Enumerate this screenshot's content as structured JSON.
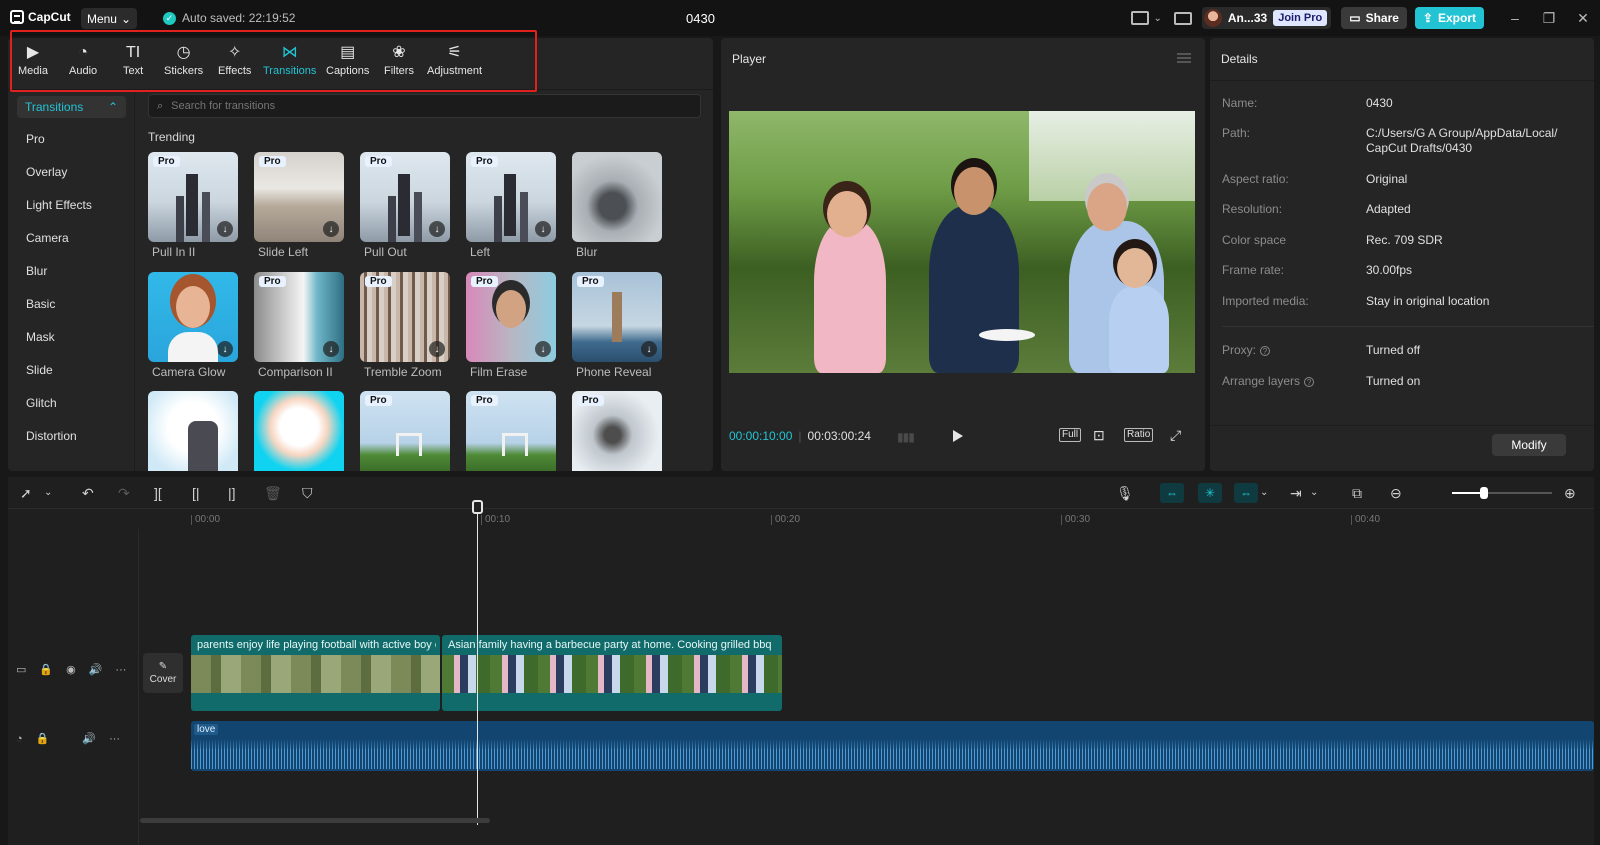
{
  "titlebar": {
    "app_name": "CapCut",
    "menu_label": "Menu",
    "autosave": "Auto saved: 22:19:52",
    "project_title": "0430",
    "user_name": "An...33",
    "join_pro": "Join Pro",
    "share_label": "Share",
    "export_label": "Export"
  },
  "toolbar": {
    "tools": [
      {
        "label": "Media",
        "icon": "media-icon"
      },
      {
        "label": "Audio",
        "icon": "audio-icon"
      },
      {
        "label": "Text",
        "icon": "text-icon"
      },
      {
        "label": "Stickers",
        "icon": "stickers-icon"
      },
      {
        "label": "Effects",
        "icon": "effects-icon"
      },
      {
        "label": "Transitions",
        "icon": "transitions-icon",
        "active": true
      },
      {
        "label": "Captions",
        "icon": "captions-icon"
      },
      {
        "label": "Filters",
        "icon": "filters-icon"
      },
      {
        "label": "Adjustment",
        "icon": "adjustment-icon"
      }
    ],
    "accent_color": "#22c4d4",
    "highlight_color": "#e0221e"
  },
  "sidebar": {
    "active": "Transitions",
    "items": [
      "Pro",
      "Overlay",
      "Light Effects",
      "Camera",
      "Blur",
      "Basic",
      "Mask",
      "Slide",
      "Glitch",
      "Distortion"
    ]
  },
  "search": {
    "placeholder": "Search for transitions"
  },
  "trending": {
    "title": "Trending",
    "items": [
      {
        "label": "Pull In II",
        "pro": true
      },
      {
        "label": "Slide Left",
        "pro": true
      },
      {
        "label": "Pull Out",
        "pro": true
      },
      {
        "label": "Left",
        "pro": true
      },
      {
        "label": "Blur",
        "pro": false
      },
      {
        "label": "Camera Glow",
        "pro": false
      },
      {
        "label": "Comparison II",
        "pro": true
      },
      {
        "label": "Tremble Zoom",
        "pro": true
      },
      {
        "label": "Film Erase",
        "pro": true
      },
      {
        "label": "Phone Reveal",
        "pro": true
      },
      {
        "label": "",
        "pro": false
      },
      {
        "label": "",
        "pro": false
      },
      {
        "label": "",
        "pro": true
      },
      {
        "label": "",
        "pro": true
      },
      {
        "label": "",
        "pro": true
      }
    ],
    "pro_badge": "Pro"
  },
  "player": {
    "title": "Player",
    "current_time": "00:00:10:00",
    "total_time": "00:03:00:24",
    "controls": [
      "Full",
      "Ratio"
    ]
  },
  "details": {
    "title": "Details",
    "rows": [
      {
        "key": "Name:",
        "value": "0430"
      },
      {
        "key": "Path:",
        "value": "C:/Users/G A Group/AppData/Local/ CapCut Drafts/0430"
      },
      {
        "key": "Aspect ratio:",
        "value": "Original"
      },
      {
        "key": "Resolution:",
        "value": "Adapted"
      },
      {
        "key": "Color space",
        "value": "Rec. 709 SDR"
      },
      {
        "key": "Frame rate:",
        "value": "30.00fps"
      },
      {
        "key": "Imported media:",
        "value": "Stay in original location"
      },
      {
        "key": "Proxy:",
        "value": "Turned off"
      },
      {
        "key": "Arrange layers",
        "value": "Turned on"
      }
    ],
    "modify_label": "Modify"
  },
  "timeline": {
    "ruler": [
      "00:00",
      "00:10",
      "00:20",
      "00:30",
      "00:40"
    ],
    "cover_label": "Cover",
    "clips": [
      {
        "title": "parents enjoy life playing football with active boy on"
      },
      {
        "title": "Asian family having a barbecue party at home. Cooking grilled bbq for c"
      }
    ],
    "audio_label": "love"
  }
}
